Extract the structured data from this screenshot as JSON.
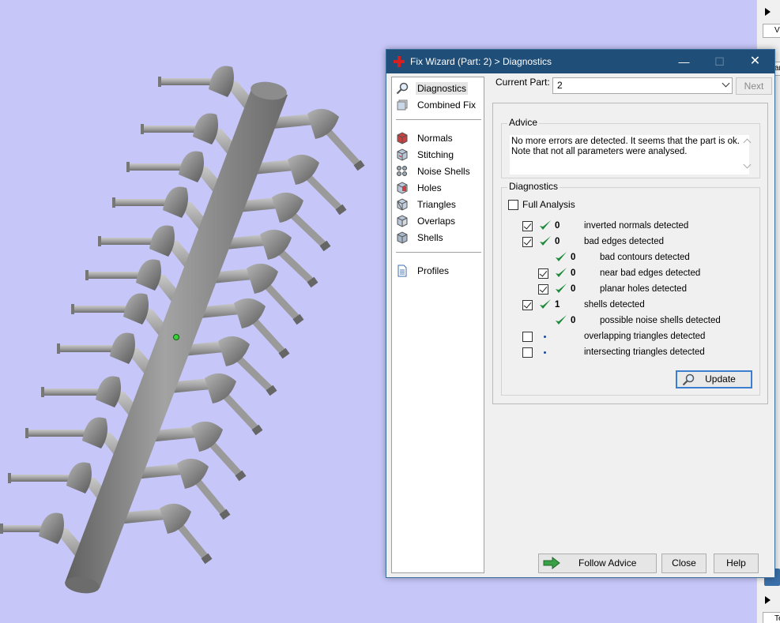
{
  "window": {
    "title": "Fix Wizard (Part: 2) > Diagnostics",
    "controls": {
      "minimize": "—",
      "maximize": "☐",
      "close": "✕"
    }
  },
  "nav": {
    "items": [
      {
        "label": "Diagnostics",
        "icon": "magnifier-icon",
        "selected": true
      },
      {
        "label": "Combined Fix",
        "icon": "combined-fix-icon"
      },
      {
        "label": "Normals",
        "icon": "normals-icon"
      },
      {
        "label": "Stitching",
        "icon": "stitching-icon"
      },
      {
        "label": "Noise Shells",
        "icon": "noise-shells-icon"
      },
      {
        "label": "Holes",
        "icon": "holes-icon"
      },
      {
        "label": "Triangles",
        "icon": "triangles-icon"
      },
      {
        "label": "Overlaps",
        "icon": "overlaps-icon"
      },
      {
        "label": "Shells",
        "icon": "shells-icon"
      },
      {
        "label": "Profiles",
        "icon": "profiles-icon"
      }
    ]
  },
  "header": {
    "current_part_label": "Current Part:",
    "current_part_value": "2",
    "next_label": "Next"
  },
  "advice": {
    "title": "Advice",
    "line1": "No more errors are detected. It seems that the part is ok.",
    "line2": "Note that not all parameters were analysed."
  },
  "diagnostics": {
    "title": "Diagnostics",
    "full_analysis_label": "Full Analysis",
    "full_analysis_checked": false,
    "rows": [
      {
        "checked": true,
        "status": "check",
        "count": "0",
        "label": "inverted normals detected",
        "indent": 0
      },
      {
        "checked": true,
        "status": "check",
        "count": "0",
        "label": "bad edges detected",
        "indent": 0
      },
      {
        "checked": null,
        "status": "check",
        "count": "0",
        "label": "bad contours detected",
        "indent": 1
      },
      {
        "checked": true,
        "status": "check",
        "count": "0",
        "label": "near bad edges detected",
        "indent": 1
      },
      {
        "checked": true,
        "status": "check",
        "count": "0",
        "label": "planar holes detected",
        "indent": 1
      },
      {
        "checked": true,
        "status": "check",
        "count": "1",
        "label": "shells detected",
        "indent": 0
      },
      {
        "checked": null,
        "status": "check",
        "count": "0",
        "label": "possible noise shells detected",
        "indent": 1
      },
      {
        "checked": false,
        "status": "dot",
        "count": "",
        "label": "overlapping triangles detected",
        "indent": 0
      },
      {
        "checked": false,
        "status": "dot",
        "count": "",
        "label": "intersecting triangles detected",
        "indent": 0
      }
    ],
    "update_label": "Update"
  },
  "footer": {
    "follow_advice_label": "Follow Advice",
    "close_label": "Close",
    "help_label": "Help"
  },
  "right_strip": {
    "box1_text": "Vi",
    "box2_text": "ar",
    "box3_text": "Te"
  },
  "colors": {
    "titlebar": "#1f4e78",
    "viewport": "#c6c6f8",
    "check_green": "#1e8a3c",
    "accent_blue": "#3c7fd0"
  }
}
